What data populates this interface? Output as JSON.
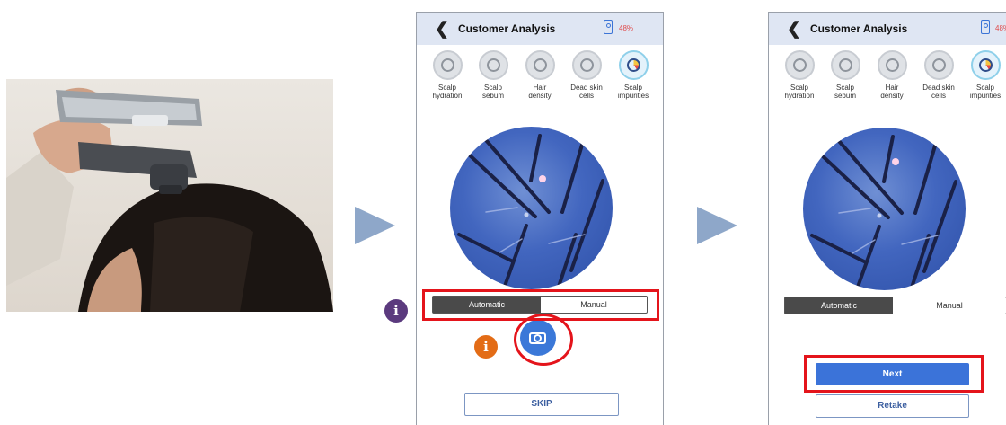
{
  "screen": {
    "title": "Customer Analysis",
    "battery_percent": "48%",
    "back_icon": "chevron-left-icon",
    "categories": [
      {
        "label_line1": "Scalp",
        "label_line2": "hydration",
        "icon": "scalp-hydration-icon"
      },
      {
        "label_line1": "Scalp",
        "label_line2": "sebum",
        "icon": "scalp-sebum-icon"
      },
      {
        "label_line1": "Hair",
        "label_line2": "density",
        "icon": "hair-density-icon"
      },
      {
        "label_line1": "Dead skin",
        "label_line2": "cells",
        "icon": "dead-skin-cells-icon"
      },
      {
        "label_line1": "Scalp",
        "label_line2": "impurities",
        "icon": "scalp-impurities-icon"
      }
    ],
    "mode_automatic": "Automatic",
    "mode_manual": "Manual",
    "selected_mode": "Automatic",
    "capture_icon": "camera-icon",
    "skip_label": "SKIP",
    "next_label": "Next",
    "retake_label": "Retake"
  },
  "callouts": {
    "info_glyph": "i",
    "purple_color": "#5b3a7e",
    "orange_color": "#e36c16",
    "highlight_color": "#e4141b"
  },
  "colors": {
    "accent_blue": "#3b73d9",
    "topbar": "#dfe6f3",
    "arrow": "#8ea7c9"
  }
}
